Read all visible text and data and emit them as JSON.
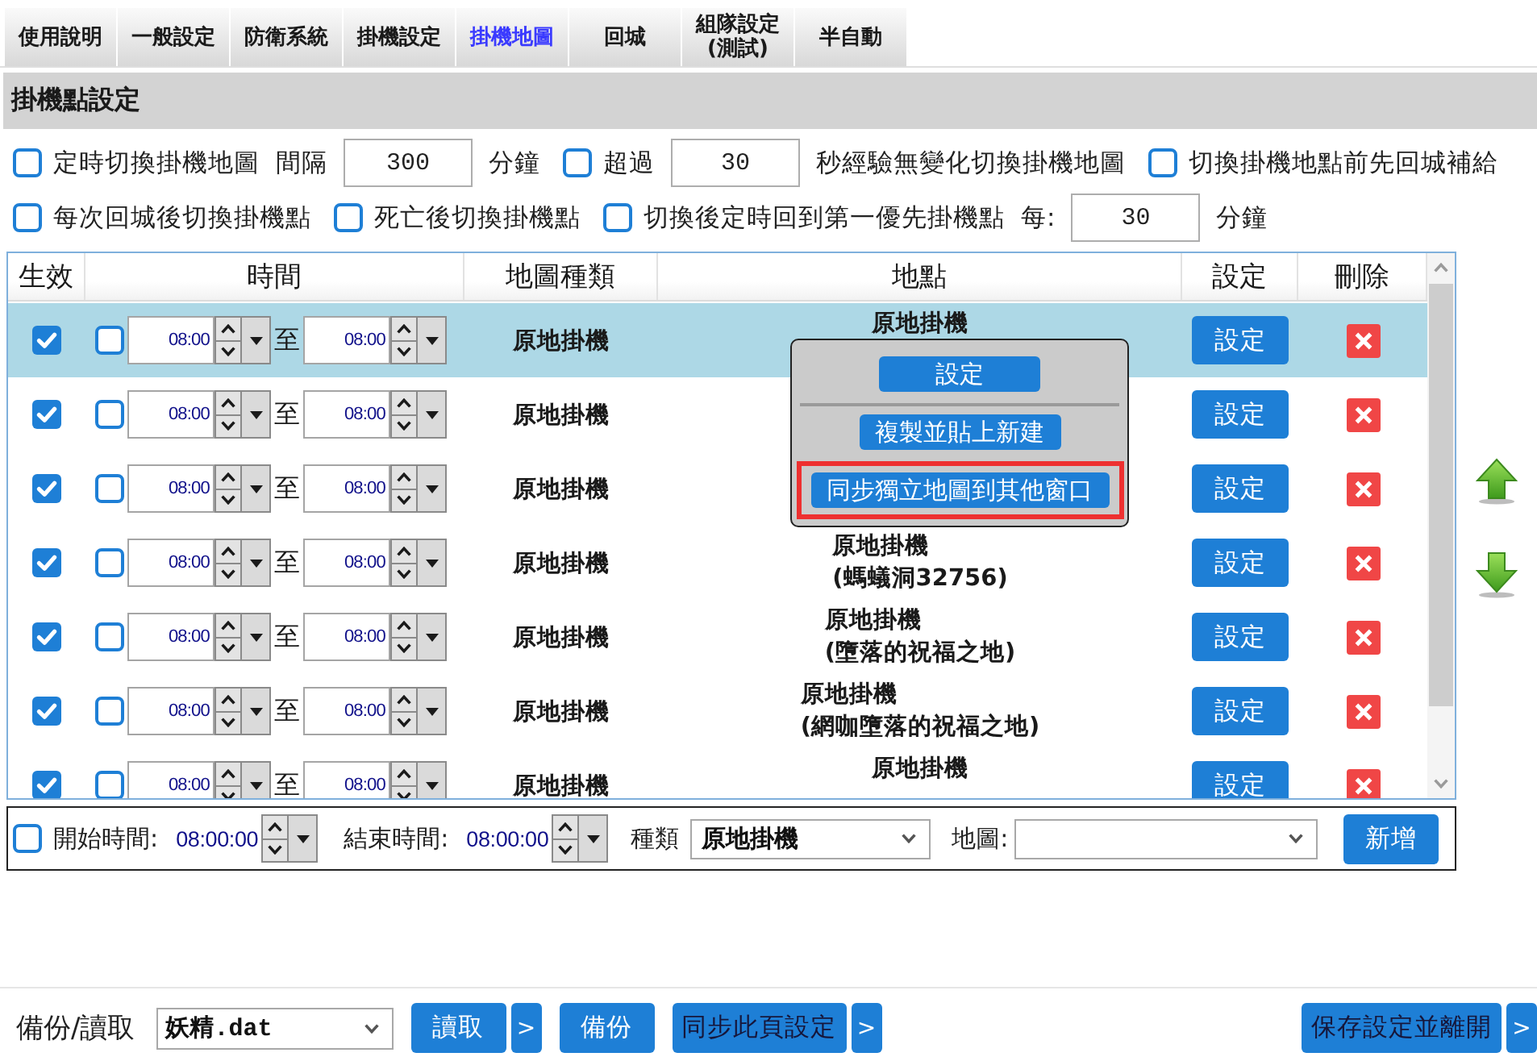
{
  "tabs": [
    {
      "label": "使用說明",
      "selected": false
    },
    {
      "label": "一般設定",
      "selected": false
    },
    {
      "label": "防衛系統",
      "selected": false
    },
    {
      "label": "掛機設定",
      "selected": false
    },
    {
      "label": "掛機地圖",
      "selected": true
    },
    {
      "label": "回城",
      "selected": false
    },
    {
      "label": "組隊設定\n(測試)",
      "selected": false
    },
    {
      "label": "半自動",
      "selected": false
    }
  ],
  "section_title": "掛機點設定",
  "option_rows": [
    [
      {
        "kind": "checkbox",
        "label": "定時切換掛機地圖",
        "checked": false
      },
      {
        "kind": "text",
        "text": "間隔"
      },
      {
        "kind": "input",
        "value": "300"
      },
      {
        "kind": "text",
        "text": "分鐘"
      },
      {
        "kind": "checkbox",
        "label": "超過",
        "checked": false
      },
      {
        "kind": "input",
        "value": "30"
      },
      {
        "kind": "text",
        "text": "秒經驗無變化切換掛機地圖"
      },
      {
        "kind": "checkbox",
        "label": "切換掛機地點前先回城補給",
        "checked": false
      }
    ],
    [
      {
        "kind": "checkbox",
        "label": "每次回城後切換掛機點",
        "checked": false
      },
      {
        "kind": "checkbox",
        "label": "死亡後切換掛機點",
        "checked": false
      },
      {
        "kind": "checkbox",
        "label": "切換後定時回到第一優先掛機點",
        "checked": false
      },
      {
        "kind": "text",
        "text": "每:"
      },
      {
        "kind": "input",
        "value": "30"
      },
      {
        "kind": "text",
        "text": "分鐘"
      }
    ]
  ],
  "table": {
    "columns": [
      "生效",
      "時間",
      "地圖種類",
      "地點",
      "設定",
      "刪除"
    ],
    "rows": [
      {
        "selected": true,
        "enabled": true,
        "timed": false,
        "start": "08:00",
        "separator": "至",
        "end": "08:00",
        "map_type": "原地掛機",
        "location": [
          "原地掛機"
        ],
        "action": "設定"
      },
      {
        "selected": false,
        "enabled": true,
        "timed": false,
        "start": "08:00",
        "separator": "至",
        "end": "08:00",
        "map_type": "原地掛機",
        "action": "設定"
      },
      {
        "selected": false,
        "enabled": true,
        "timed": false,
        "start": "08:00",
        "separator": "至",
        "end": "08:00",
        "map_type": "原地掛機",
        "action": "設定"
      },
      {
        "selected": false,
        "enabled": true,
        "timed": false,
        "start": "08:00",
        "separator": "至",
        "end": "08:00",
        "map_type": "原地掛機",
        "location": [
          "原地掛機",
          "(螞蟻洞32756)"
        ],
        "action": "設定"
      },
      {
        "selected": false,
        "enabled": true,
        "timed": false,
        "start": "08:00",
        "separator": "至",
        "end": "08:00",
        "map_type": "原地掛機",
        "location": [
          "原地掛機",
          "(墮落的祝福之地)"
        ],
        "action": "設定"
      },
      {
        "selected": false,
        "enabled": true,
        "timed": false,
        "start": "08:00",
        "separator": "至",
        "end": "08:00",
        "map_type": "原地掛機",
        "location": [
          "原地掛機",
          "(網咖墮落的祝福之地)"
        ],
        "action": "設定"
      },
      {
        "selected": false,
        "enabled": true,
        "timed": false,
        "start": "08:00",
        "separator": "至",
        "end": "08:00",
        "map_type": "原地掛機",
        "location": [
          "原地掛機"
        ],
        "action": "設定"
      }
    ]
  },
  "context_menu": {
    "items": [
      {
        "kind": "button",
        "label": "設定",
        "highlighted": false
      },
      {
        "kind": "separator"
      },
      {
        "kind": "button",
        "label": "複製並貼上新建",
        "highlighted": false
      },
      {
        "kind": "button",
        "label": "同步獨立地圖到其他窗口",
        "highlighted": true
      }
    ]
  },
  "add_bar": {
    "timed": false,
    "start_label": "開始時間:",
    "start": "08:00:00",
    "end_label": "結束時間:",
    "end": "08:00:00",
    "type_label": "種類",
    "type": "原地掛機",
    "map_label": "地圖:",
    "button": "新增"
  },
  "footer": {
    "label": "備份/讀取",
    "file": "妖精.dat",
    "buttons": [
      {
        "label": "讀取",
        "kind": "main",
        "dark_text": false
      },
      {
        "label": ">",
        "kind": "more"
      },
      {
        "label": "備份",
        "kind": "main",
        "dark_text": false
      },
      {
        "label": "同步此頁設定",
        "kind": "main",
        "dark_text": true
      },
      {
        "label": ">",
        "kind": "more"
      }
    ],
    "right_buttons": [
      {
        "label": "保存設定並離開",
        "kind": "main",
        "dark_text": true
      },
      {
        "label": ">",
        "kind": "more"
      }
    ]
  }
}
